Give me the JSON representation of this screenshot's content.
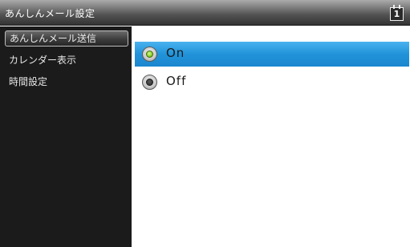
{
  "header": {
    "title": "あんしんメール設定",
    "calendar_icon": "calendar-icon",
    "calendar_day": "1"
  },
  "sidebar": {
    "items": [
      {
        "label": "あんしんメール送信",
        "selected": true
      },
      {
        "label": "カレンダー表示",
        "selected": false
      },
      {
        "label": "時間設定",
        "selected": false
      }
    ]
  },
  "main": {
    "options": [
      {
        "label": "On",
        "checked": true
      },
      {
        "label": "Off",
        "checked": false
      }
    ]
  },
  "colors": {
    "highlight": "#2193d9",
    "radio_on": "#8fd22c",
    "sidebar_bg": "#1b1b1b"
  }
}
